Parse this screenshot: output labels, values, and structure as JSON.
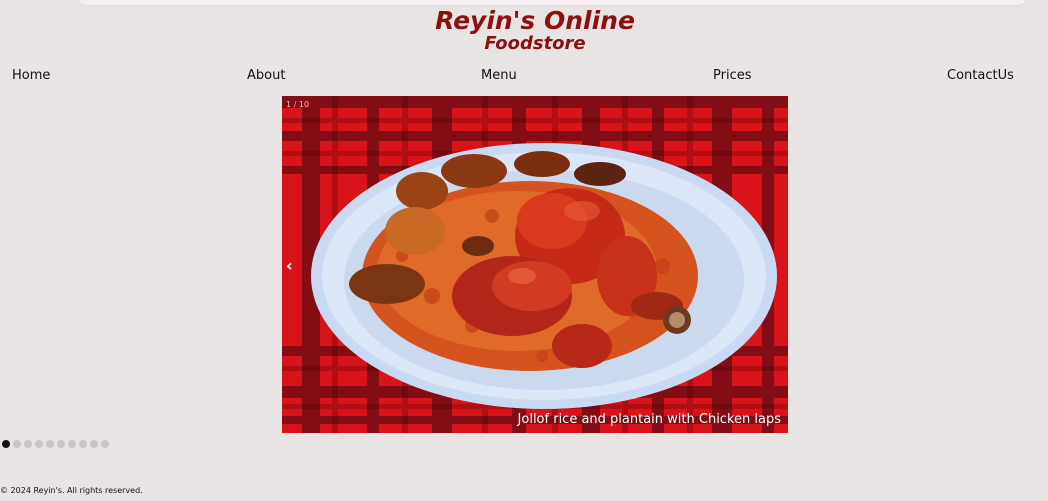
{
  "header": {
    "title_line1": "Reyin's Online",
    "title_line2": "Foodstore"
  },
  "nav": {
    "items": [
      "Home",
      "About",
      "Menu",
      "Prices",
      "ContactUs"
    ]
  },
  "slideshow": {
    "slide_number": "1 / 10",
    "prev_label": "‹",
    "caption": "Jollof rice and plantain with Chicken laps",
    "dot_count": 10,
    "active_index": 0
  },
  "footer": {
    "text": "© 2024 Reyin's. All rights reserved."
  },
  "colors": {
    "background": "#e8e4e3",
    "title": "#8b1111",
    "tablecloth": "#d8131a"
  }
}
